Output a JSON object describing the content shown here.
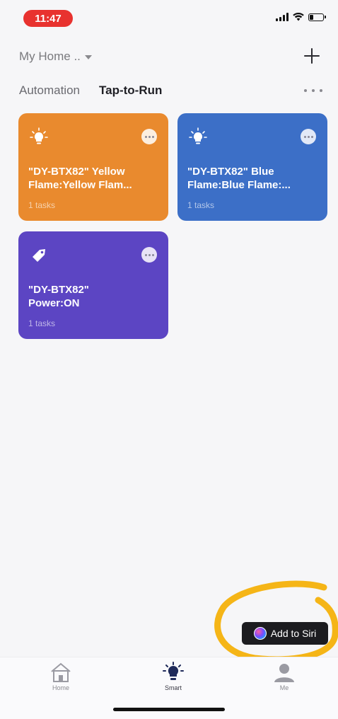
{
  "status_bar": {
    "time": "11:47",
    "signal_icon": "cellular-signal-icon",
    "wifi_icon": "wifi-icon",
    "battery_icon": "battery-icon",
    "battery_level": 0.25
  },
  "header": {
    "home_name": "My Home ..",
    "home_dropdown_icon": "chevron-down-icon",
    "add_icon": "plus-icon"
  },
  "tabs": [
    {
      "label": "Automation",
      "active": false
    },
    {
      "label": "Tap-to-Run",
      "active": true
    }
  ],
  "more_icon": "ellipsis-icon",
  "cards": [
    {
      "title": "\"DY-BTX82\" Yellow Flame:Yellow Flam...",
      "tasks": "1 tasks",
      "icon": "lightbulb-icon",
      "color": "#e98a2e"
    },
    {
      "title": "\"DY-BTX82\" Blue Flame:Blue Flame:...",
      "tasks": "1 tasks",
      "icon": "lightbulb-icon",
      "color": "#3c6fc7"
    },
    {
      "title": "\"DY-BTX82\"\nPower:ON",
      "tasks": "1 tasks",
      "icon": "tag-icon",
      "color": "#5c45c3"
    }
  ],
  "siri": {
    "label": "Add to Siri",
    "icon": "siri-icon"
  },
  "annotation": {
    "color": "#f5b517"
  },
  "tabbar": [
    {
      "label": "Home",
      "icon": "home-icon",
      "active": false
    },
    {
      "label": "Smart",
      "icon": "smart-bulb-icon",
      "active": true
    },
    {
      "label": "Me",
      "icon": "person-icon",
      "active": false
    }
  ]
}
